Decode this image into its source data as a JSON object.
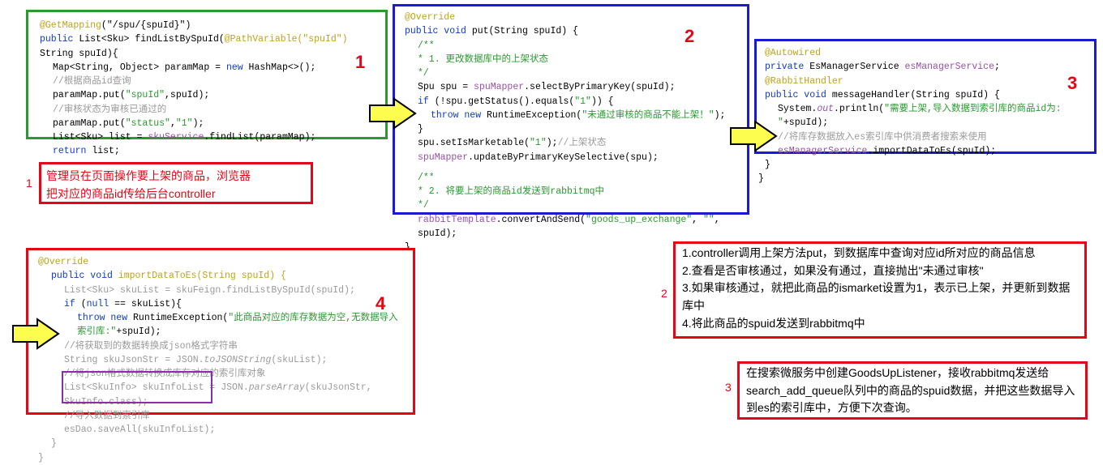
{
  "block1": {
    "l1_ann": "@GetMapping",
    "l1_args": "(\"/spu/{spuId}\")",
    "l2_a": "public ",
    "l2_b": "List<Sku> findListBySpuId(",
    "l2_c": "@PathVariable(\"spuId\")",
    "l2_d": " String spuId){",
    "l3_a": "Map<String, Object> paramMap = ",
    "l3_b": "new ",
    "l3_c": "HashMap<>();",
    "l4": "//根据商品id查询",
    "l5_a": "paramMap.put(",
    "l5_b": "\"spuId\"",
    "l5_c": ",spuId);",
    "l6": "//审核状态为审核已通过的",
    "l7_a": "paramMap.put(",
    "l7_b": "\"status\"",
    "l7_c": ",",
    "l7_d": "\"1\"",
    "l7_e": ");",
    "l8_a": "List<Sku> list = ",
    "l8_b": "skuService",
    "l8_c": ".findList(paramMap);",
    "l9_a": "return ",
    "l9_b": "list;"
  },
  "block2": {
    "l1": "@Override",
    "l2_a": "public void ",
    "l2_b": "put(String spuId) {",
    "l3": "/**",
    "l4": " * 1. 更改数据库中的上架状态",
    "l5": " */",
    "l6_a": "Spu spu = ",
    "l6_b": "spuMapper",
    "l6_c": ".selectByPrimaryKey(spuId);",
    "l7_a": "if ",
    "l7_b": "(!spu.getStatus().equals(",
    "l7_c": "\"1\"",
    "l7_d": ")) {",
    "l8_a": "throw new ",
    "l8_b": "RuntimeException(",
    "l8_c": "\"未通过审核的商品不能上架！\"",
    "l8_d": ");",
    "l9": "}",
    "l10_a": "spu.setIsMarketable(",
    "l10_b": "\"1\"",
    "l10_c": ");",
    "l10_d": "//上架状态",
    "l11_a": "spuMapper",
    "l11_b": ".updateByPrimaryKeySelective(spu);",
    "l12": "/**",
    "l13": " * 2. 将要上架的商品id发送到rabbitmq中",
    "l14": " */",
    "l15_a": "rabbitTemplate",
    "l15_b": ".convertAndSend(",
    "l15_c": "\"goods_up_exchange\"",
    "l15_d": ", ",
    "l15_e": "\"\"",
    "l15_f": ", spuId);",
    "l16": "}"
  },
  "block3": {
    "l1": "@Autowired",
    "l2_a": "private ",
    "l2_b": "EsManagerService ",
    "l2_c": "esManagerService",
    "l2_d": ";",
    "l3": "@RabbitHandler",
    "l4_a": "public void ",
    "l4_b": "messageHandler(String spuId) {",
    "l5_a": "System.",
    "l5_b": "out",
    "l5_c": ".println(",
    "l5_d": "\"需要上架,导入数据到索引库的商品id为: \"",
    "l5_e": "+spuId);",
    "l6": "//将库存数据放入es索引库中供消费者搜索来使用",
    "l7_a": "esManagerService",
    "l7_b": ".importDataToEs(spuId);",
    "l8": "}",
    "l9": "}"
  },
  "block4": {
    "l1": "@Override",
    "l2_a": "public void ",
    "l2_b": "importDataToEs(String spuId) {",
    "l3_a": "List<Sku> skuList = ",
    "l3_b": "skuFeign",
    "l3_c": ".findListBySpuId(spuId);",
    "l4_a": "if ",
    "l4_b": "(",
    "l4_c": "null ",
    "l4_d": "== skuList){",
    "l5_a": "throw new ",
    "l5_b": "RuntimeException(",
    "l5_c": "\"此商品对应的库存数据为空,无数据导入索引库:\"",
    "l5_d": "+spuId);",
    "l6": "//将获取到的数据转换成json格式字符串",
    "l7_a": "String skuJsonStr = JSON.",
    "l7_b": "toJSONString",
    "l7_c": "(skuList);",
    "l8": "//将json格式数据转换成库存对应的索引库对象",
    "l9_a": "List<SkuInfo> skuInfoList = JSON.",
    "l9_b": "parseArray",
    "l9_c": "(skuJsonStr, SkuInfo.",
    "l9_d": "class",
    "l9_e": ");",
    "l10": "//导入数据到索引库",
    "l11_a": "esDao",
    "l11_b": ".saveAll(skuInfoList);",
    "l12": "}",
    "l13": "}"
  },
  "label1": {
    "l1": "管理员在页面操作要上架的商品，浏览器",
    "l2": "把对应的商品id传给后台controller"
  },
  "label2": {
    "l1": "1.controller调用上架方法put，到数据库中查询对应id所对应的商品信息",
    "l2": "2.查看是否审核通过，如果没有通过，直接抛出\"未通过审核\"",
    "l3": "3.如果审核通过，就把此商品的ismarket设置为1，表示已上架，并更新到数据库中",
    "l4": "4.将此商品的spuid发送到rabbitmq中"
  },
  "label3": {
    "t": "在搜索微服务中创建GoodsUpListener，接收rabbitmq发送给search_add_queue队列中的商品的spuid数据，并把这些数据导入到es的索引库中，方便下次查询。"
  },
  "nums": {
    "n1": "1",
    "n2": "2",
    "n3": "3",
    "n4": "4",
    "s1": "1",
    "s2": "2",
    "s3": "3"
  }
}
